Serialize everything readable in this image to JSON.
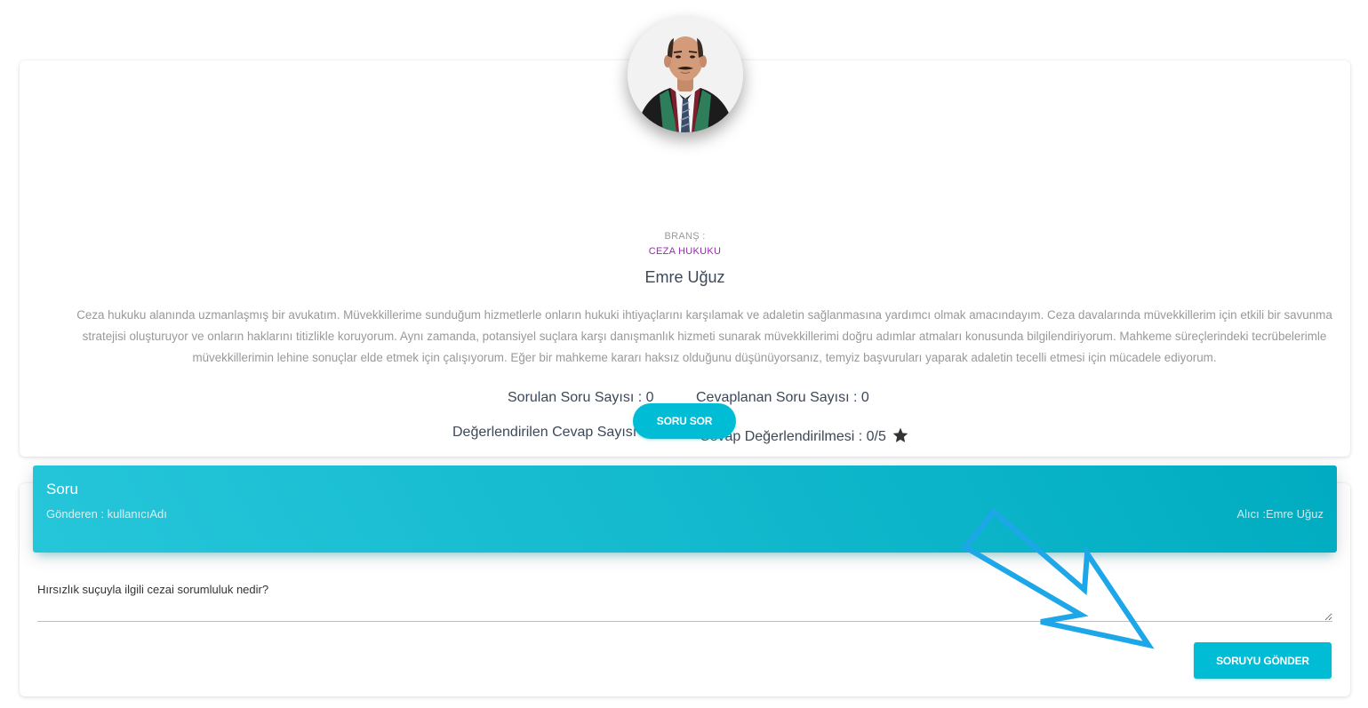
{
  "profile": {
    "branch_label": "BRANŞ :",
    "branch_value": "CEZA HUKUKU",
    "name": "Emre Uğuz",
    "bio": "Ceza hukuku alanında uzmanlaşmış bir avukatım. Müvekkillerime sunduğum hizmetlerle onların hukuki ihtiyaçlarını karşılamak ve adaletin sağlanmasına yardımcı olmak amacındayım. Ceza davalarında müvekkillerim için etkili bir savunma stratejisi oluşturuyor ve onların haklarını titizlikle koruyorum. Aynı zamanda, potansiyel suçlara karşı danışmanlık hizmeti sunarak müvekkillerimi doğru adımlar atmaları konusunda bilgilendiriyorum. Mahkeme süreçlerindeki tecrübelerimle müvekkillerimin lehine sonuçlar elde etmek için çalışıyorum. Eğer bir mahkeme kararı haksız olduğunu düşünüyorsanız, temyiz başvuruları yaparak adaletin tecelli etmesi için mücadele ediyorum.",
    "stats": {
      "asked": "Sorulan Soru Sayısı : 0",
      "answered": "Cevaplanan Soru Sayısı : 0",
      "rated_count": "Değerlendirilen Cevap Sayısı : 0",
      "rating": "Cevap Değerlendirilmesi : 0/5"
    },
    "ask_button": "SORU SOR"
  },
  "question_form": {
    "title": "Soru",
    "sender": "Gönderen : kullanıcıAdı",
    "recipient": "Alıcı :Emre Uğuz",
    "question_value": "Hırsızlık suçuyla ilgili cezai sorumluluk nedir?",
    "send_button": "SORUYU GÖNDER"
  },
  "colors": {
    "accent": "#00bcd4",
    "branch": "#9c27b0",
    "annotation_arrow": "#1ea7e8"
  },
  "icons": {
    "rating": "star-icon",
    "avatar": "lawyer-portrait",
    "annotation": "arrow-annotation"
  }
}
